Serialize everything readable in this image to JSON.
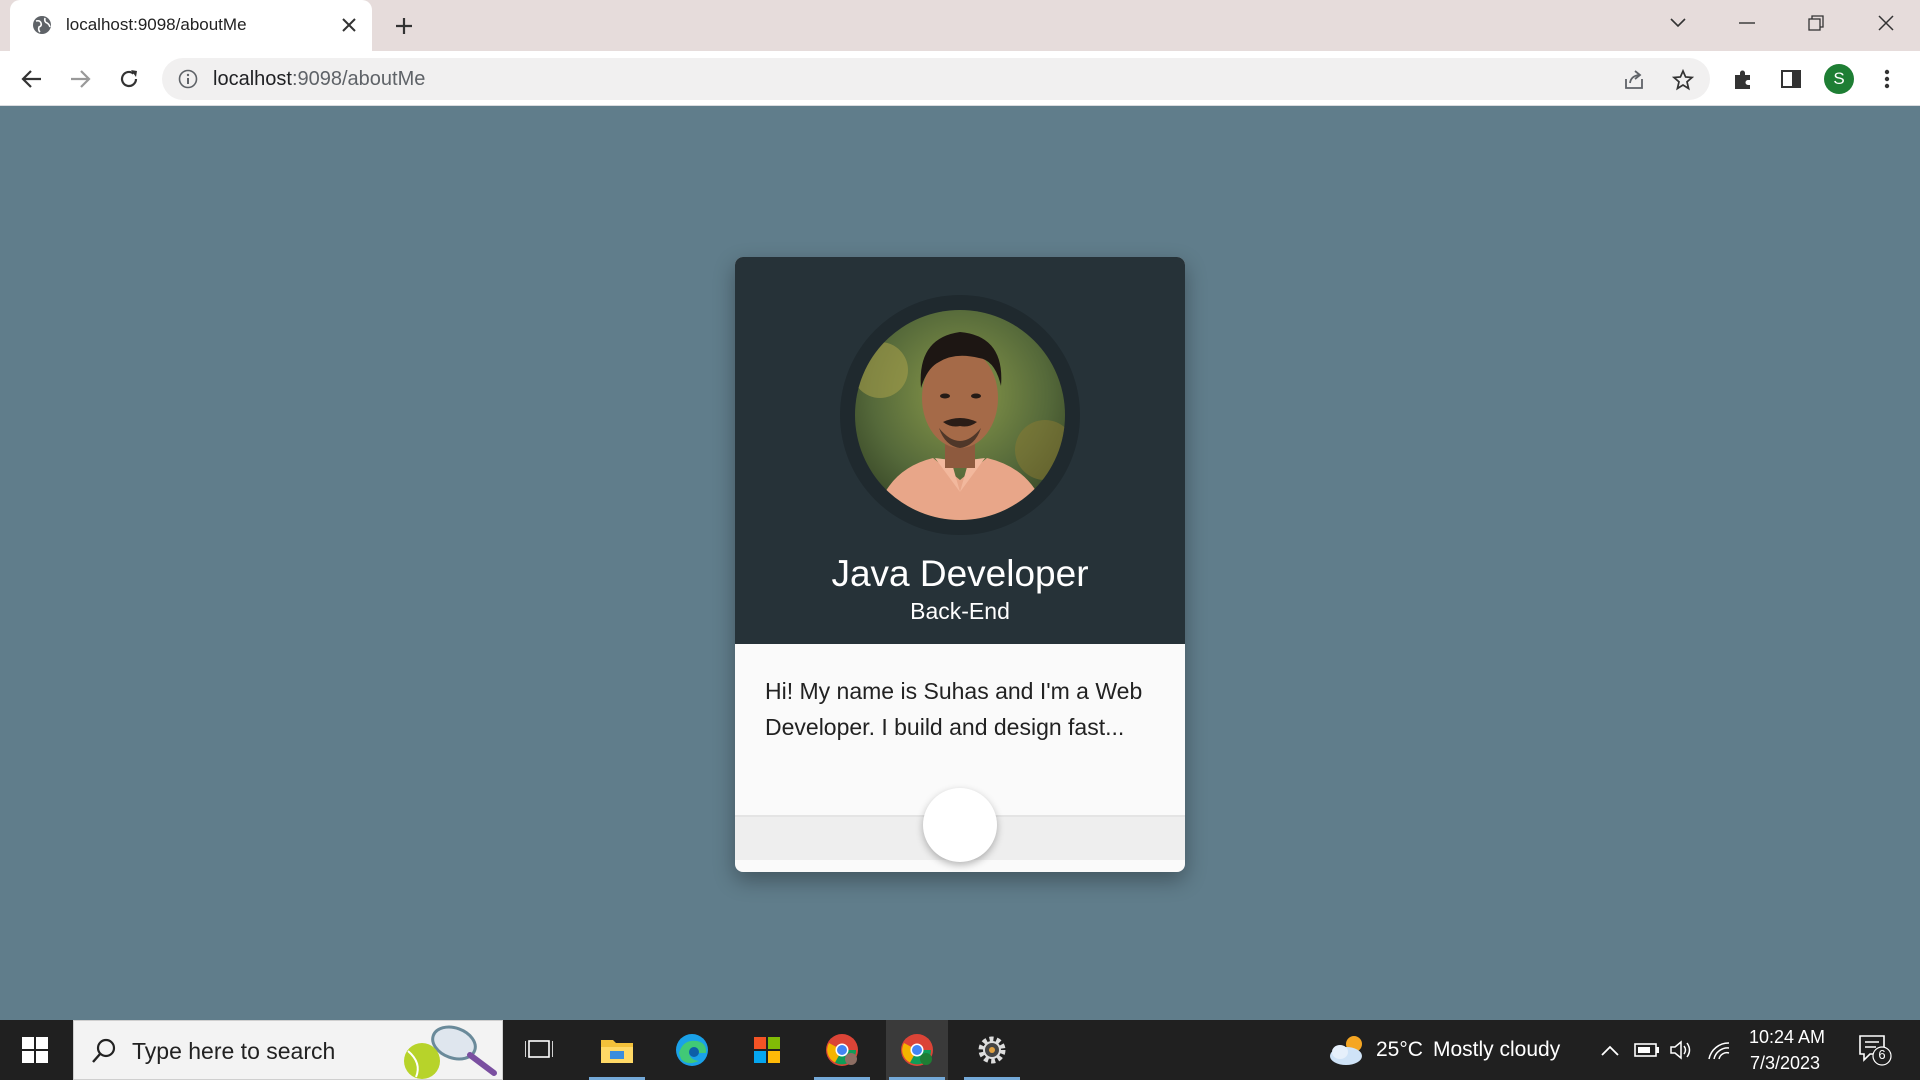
{
  "browser": {
    "tab_title": "localhost:9098/aboutMe",
    "url_host": "localhost",
    "url_path": ":9098/aboutMe",
    "profile_initial": "S"
  },
  "card": {
    "title": "Java Developer",
    "subtitle": "Back-End",
    "description": "Hi! My name is Suhas and I'm a Web Developer. I build and design fast..."
  },
  "taskbar": {
    "search_placeholder": "Type here to search",
    "weather_temp": "25°C",
    "weather_text": "Mostly cloudy",
    "time": "10:24 AM",
    "date": "7/3/2023",
    "notification_count": "6"
  },
  "colors": {
    "page_background": "#607d8b",
    "card_header": "#263238",
    "card_body": "#fafafa"
  }
}
